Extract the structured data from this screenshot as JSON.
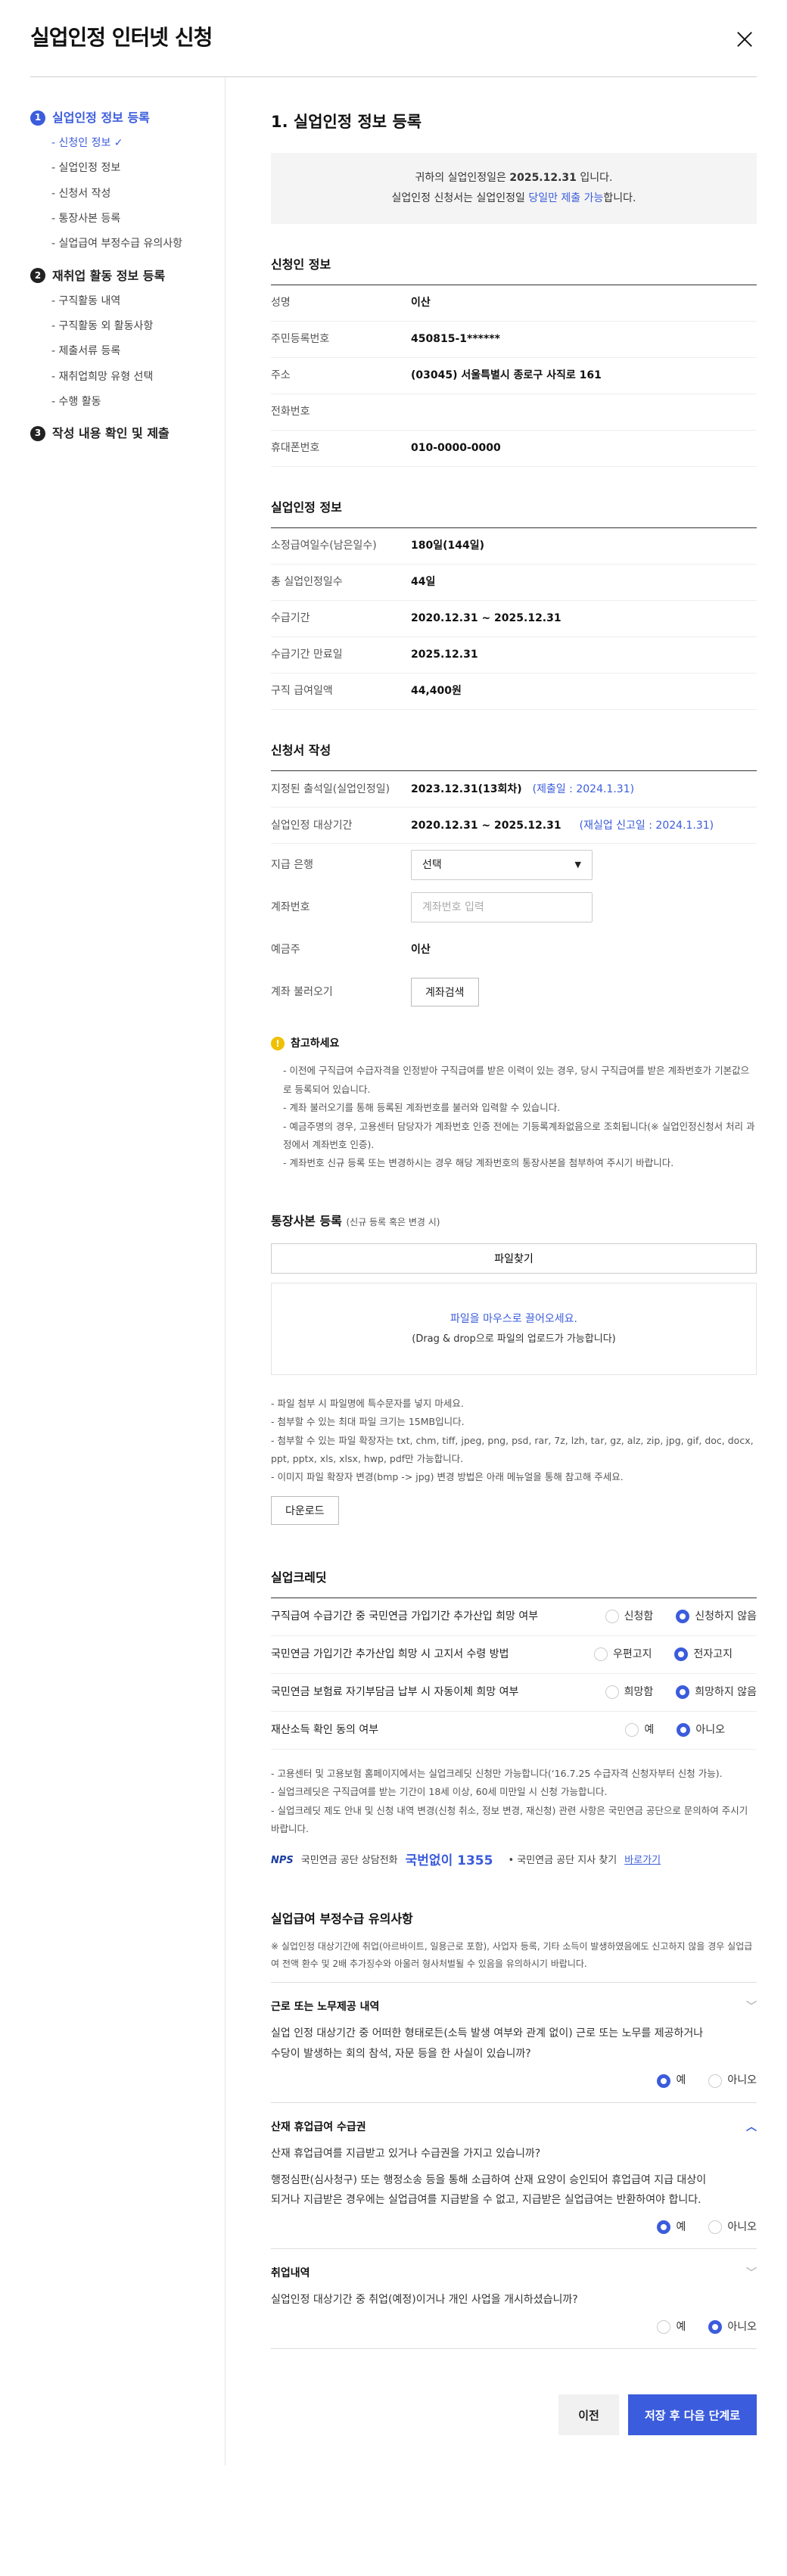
{
  "title": "실업인정 인터넷 신청",
  "sidebar": {
    "steps": [
      {
        "num": "1",
        "label": "실업인정 정보 등록",
        "subs": [
          "- 신청인 정보 ✓",
          "- 실업인정 정보",
          "- 신청서 작성",
          "- 통장사본 등록",
          "- 실업급여 부정수급 유의사항"
        ]
      },
      {
        "num": "2",
        "label": "재취업 활동 정보 등록",
        "subs": [
          "- 구직활동 내역",
          "- 구직활동 외 활동사항",
          "- 제출서류 등록",
          "- 재취업희망 유형 선택",
          "- 수행 활동"
        ]
      },
      {
        "num": "3",
        "label": "작성 내용 확인 및 제출",
        "subs": []
      }
    ]
  },
  "main": {
    "heading": "1. 실업인정 정보 등록",
    "notice": {
      "l1a": "귀하의 실업인정일은 ",
      "l1b": "2025.12.31",
      "l1c": " 입니다.",
      "l2a": "실업인정 신청서는 실업인정일 ",
      "l2b": "당일만 제출 가능",
      "l2c": "합니다."
    },
    "applicant": {
      "title": "신청인 정보",
      "rows": [
        [
          "성명",
          "이산"
        ],
        [
          "주민등록번호",
          "450815-1******"
        ],
        [
          "주소",
          "(03045) 서울특별시 종로구 사직로 161"
        ],
        [
          "전화번호",
          ""
        ],
        [
          "휴대폰번호",
          "010-0000-0000"
        ]
      ]
    },
    "recog": {
      "title": "실업인정 정보",
      "rows": [
        [
          "소정급여일수(남은일수)",
          "180일(144일)"
        ],
        [
          "총 실업인정일수",
          "44일"
        ],
        [
          "수급기간",
          "2020.12.31 ~ 2025.12.31"
        ],
        [
          "수급기간 만료일",
          "2025.12.31"
        ],
        [
          "구직 급여일액",
          "44,400원"
        ]
      ]
    },
    "form": {
      "title": "신청서 작성",
      "r1k": "지정된 출석일(실업인정일)",
      "r1v": "2023.12.31",
      "r1b": " (13회차)",
      "r1c": "(제출일 : 2024.1.31)",
      "r2k": "실업인정 대상기간",
      "r2v": "2020.12.31 ~ 2025.12.31",
      "r2c": "(재실업 신고일 : 2024.1.31)",
      "bank_k": "지급 은행",
      "bank_v": "선택",
      "bank_arrow": "▼",
      "acct_k": "계좌번호",
      "acct_ph": "계좌번호 입력",
      "holder_k": "예금주",
      "holder_v": "이산",
      "load_k": "계좌 불러오기",
      "load_btn": "계좌검색"
    },
    "ref": {
      "title": "참고하세요",
      "items": [
        "이전에 구직급여 수급자격을 인정받아 구직급여를 받은 이력이 있는 경우, 당시 구직급여를 받은 계좌번호가 기본값으로 등록되어 있습니다.",
        "계좌 불러오기를 통해 등록된 계좌번호를 불러와 입력할 수 있습니다.",
        "예금주명의 경우, 고용센터 담당자가 계좌번호 인증 전에는 기등록계좌없음으로 조회됩니다(※ 실업인정신청서 처리 과정에서 계좌번호 인증).",
        "계좌번호 신규 등록 또는 변경하시는 경우 해당 계좌번호의 통장사본을 첨부하여 주시기 바랍니다."
      ]
    },
    "bankbook": {
      "title": "통장사본 등록",
      "sub": "(신규 등록 혹은 변경 시)",
      "file_btn": "파일찾기",
      "drop1": "파일을 마우스로 끌어오세요.",
      "drop2": "(Drag & drop으로 파일의 업로드가 가능합니다)",
      "notes": [
        "- 파일 첨부 시 파일명에 특수문자를 넣지 마세요.",
        "- 첨부할 수 있는 최대 파일 크기는 15MB입니다.",
        "- 첨부할 수 있는 파일 확장자는 txt, chm, tiff, jpeg, png, psd, rar, 7z, lzh, tar, gz, alz, zip, jpg, gif, doc, docx, ppt, pptx, xls, xlsx, hwp, pdf만 가능합니다.",
        "- 이미지 파일 확장자 변경(bmp -> jpg) 변경 방법은 아래 메뉴얼을 통해 참고해 주세요."
      ],
      "download": "다운로드"
    },
    "credit": {
      "title": "실업크레딧",
      "rows": [
        {
          "q": "구직급여 수급기간 중 국민연금 가입기간 추가산입 희망 여부",
          "a": "신청함",
          "b": "신청하지 않음"
        },
        {
          "q": "국민연금 가입기간 추가산입 희망 시 고지서 수령 방법",
          "a": "우편고지",
          "b": "전자고지"
        },
        {
          "q": "국민연금 보험료 자기부담금 납부 시 자동이체 희망 여부",
          "a": "희망함",
          "b": "희망하지 않음"
        },
        {
          "q": "재산소득 확인 동의 여부",
          "a": "예",
          "b": "아니오"
        }
      ],
      "notes": [
        "- 고용센터 및 고용보험 홈페이지에서는 실업크레딧 신청만 가능합니다(‘16.7.25 수급자격 신청자부터 신청 가능).",
        "- 실업크레딧은 구직급여를 받는 기간이 18세 이상, 60세 미만일 시 신청 가능합니다.",
        "- 실업크레딧 제도 안내 및 신청 내역 변경(신청 취소, 정보 변경, 재신청) 관련 사항은 국민연금 공단으로 문의하여 주시기 바랍니다."
      ],
      "nps_logo": "NPS",
      "nps_label": "국민연금 공단 상담전화",
      "nps_phone": "국번없이 1355",
      "nps_branch": "•  국민연금 공단 지사 찾기",
      "nps_link": "바로가기"
    },
    "fraud": {
      "title": "실업급여 부정수급 유의사항",
      "intro": "※ 실업인정 대상기간에 취업(아르바이트, 일용근로 포함), 사업자 등록, 기타 소득이 발생하였음에도 신고하지 않을 경우 실업급여 전액 환수 및 2배 추가징수와 아울러 형사처벌될 수 있음을 유의하시기 바랍니다.",
      "items": [
        {
          "title": "근로 또는 노무제공 내역",
          "chev": "﹀",
          "body": [
            "실업 인정 대상기간 중 어떠한 형태로든(소득 발생 여부와 관계 없이) 근로 또는 노무를 제공하거나",
            "수당이 발생하는 회의 참석, 자문 등을 한 사실이 있습니까?"
          ],
          "yes": "예",
          "no": "아니오"
        },
        {
          "title": "산재 휴업급여 수급권",
          "chev": "︿",
          "body": [
            "산재 휴업급여를 지급받고 있거나 수급권을 가지고 있습니까?",
            "행정심판(심사청구) 또는 행정소송 등을 통해 소급하여 산재 요양이 승인되어 휴업급여 지급 대상이",
            "되거나 지급받은 경우에는 실업급여를 지급받을 수 없고, 지급받은 실업급여는 반환하여야 합니다."
          ],
          "yes": "예",
          "no": "아니오"
        },
        {
          "title": "취업내역",
          "chev": "﹀",
          "body": [
            "실업인정 대상기간 중 취업(예정)이거나 개인 사업을 개시하셨습니까?"
          ],
          "yes": "예",
          "no": "아니오"
        }
      ]
    },
    "buttons": {
      "prev": "이전",
      "next": "저장 후 다음 단계로"
    }
  },
  "close_icon": "×",
  "accent": "#3b5cdc"
}
